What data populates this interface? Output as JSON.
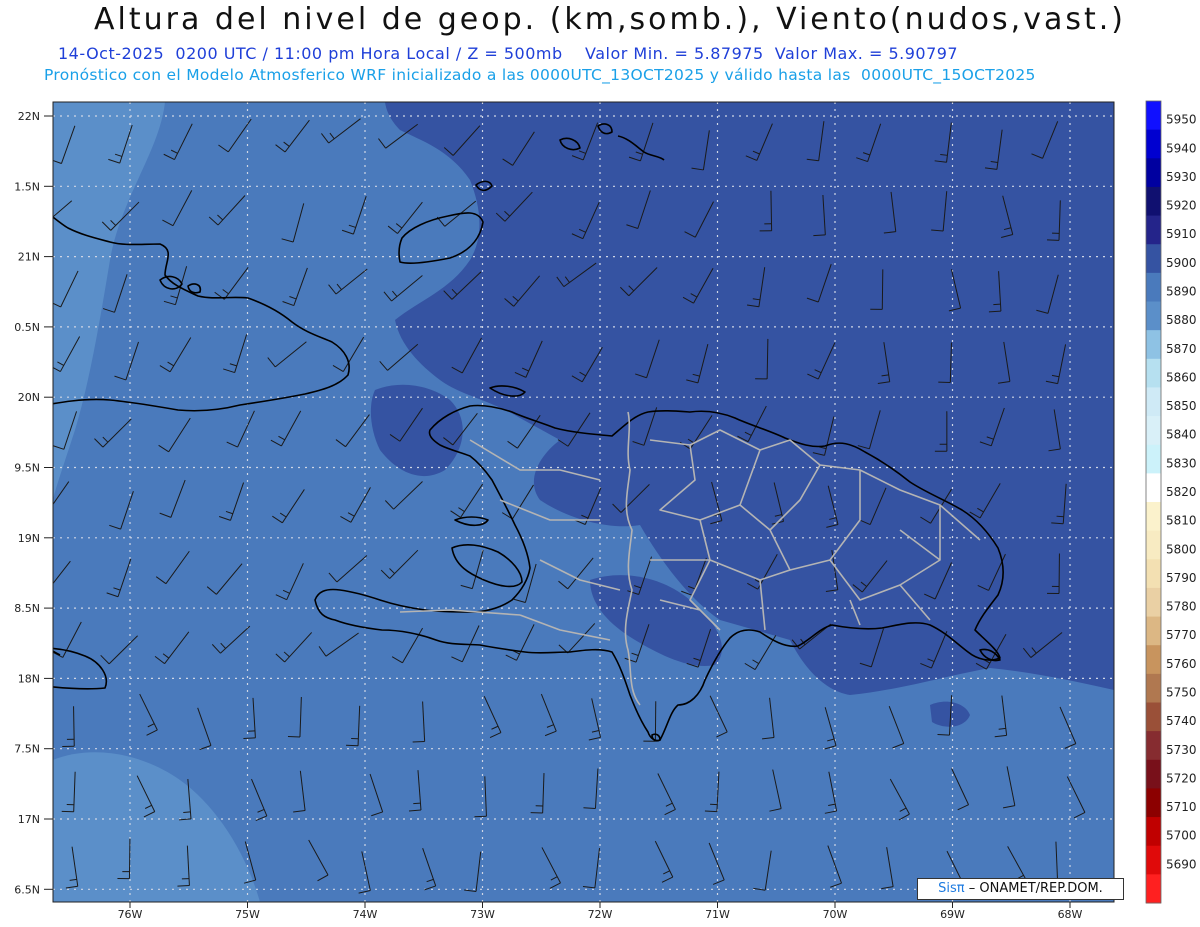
{
  "header": {
    "title": "Altura del nivel de geop. (km,somb.), Viento(nudos,vast.)",
    "subtitle": "14-Oct-2025  0200 UTC / 11:00 pm Hora Local / Z = 500mb    Valor Min. = 5.87975  Valor Max. = 5.90797",
    "model_line": "Pronóstico con el Modelo Atmosferico WRF inicializado a las 0000UTC_13OCT2025 y válido hasta las  0000UTC_15OCT2025"
  },
  "map": {
    "lat_labels": [
      "22N",
      "1.5N",
      "21N",
      "0.5N",
      "20N",
      "9.5N",
      "19N",
      "8.5N",
      "18N",
      "7.5N",
      "17N",
      "6.5N"
    ],
    "lon_labels": [
      "76W",
      "75W",
      "74W",
      "73W",
      "72W",
      "71W",
      "70W",
      "69W",
      "68W"
    ],
    "colors": {
      "level_5880": "#5b8fc9",
      "level_5890": "#4a7abc",
      "level_5900": "#3553a2",
      "grid": "#cfd6e6",
      "coast": "#000000",
      "provinces": "#b4b4b4"
    }
  },
  "colorbar": {
    "labels": [
      "5950",
      "5940",
      "5930",
      "5920",
      "5910",
      "5900",
      "5890",
      "5880",
      "5870",
      "5860",
      "5850",
      "5840",
      "5830",
      "5820",
      "5810",
      "5800",
      "5790",
      "5780",
      "5770",
      "5760",
      "5750",
      "5740",
      "5730",
      "5720",
      "5710",
      "5700",
      "5690"
    ],
    "colors": [
      "#1010ff",
      "#0000d0",
      "#0000a0",
      "#101070",
      "#24248a",
      "#3553a2",
      "#4a7abc",
      "#5b8fc9",
      "#8ec2e4",
      "#b6e0f0",
      "#cfeaf6",
      "#d9f0f8",
      "#ccf2fa",
      "#ffffff",
      "#fbf2cc",
      "#f8ebc2",
      "#f3e0b2",
      "#ead0a4",
      "#dcb784",
      "#c8945e",
      "#b07850",
      "#9a5038",
      "#862c30",
      "#78101a",
      "#8c0000",
      "#c00000",
      "#e00a0a",
      "#ff2020"
    ]
  },
  "credit": {
    "brand": "Sisπ",
    "text": "– ONAMET/REP.DOM."
  }
}
